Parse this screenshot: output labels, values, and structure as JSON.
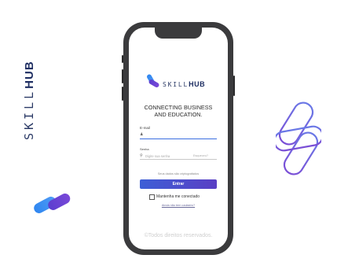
{
  "brand": {
    "word_light": "SKILL",
    "word_bold": "HUB"
  },
  "login": {
    "tagline_line1": "CONNECTING BUSINESS",
    "tagline_line2": "AND EDUCATION.",
    "email_label": "E-mail",
    "email_value": "",
    "password_label": "Senha",
    "password_placeholder": "Digite sua senha",
    "password_hint": "Esqueceu?",
    "privacy_text": "Seus dados são criptografados",
    "enter_label": "Entrar",
    "remember_label": "Mantenha me conectado",
    "signup_text": "Ainda não tem cadastro?",
    "footer": "©Todos direitos reservados."
  },
  "colors": {
    "brand_blue": "#3b8df0",
    "brand_purple": "#6a3fd1",
    "button_start": "#3d5fd6",
    "button_end": "#5a3fc4",
    "phone_frame": "#3b3b3d"
  },
  "icons": [
    "capsule-logo-icon",
    "lock-icon",
    "person-icon"
  ]
}
